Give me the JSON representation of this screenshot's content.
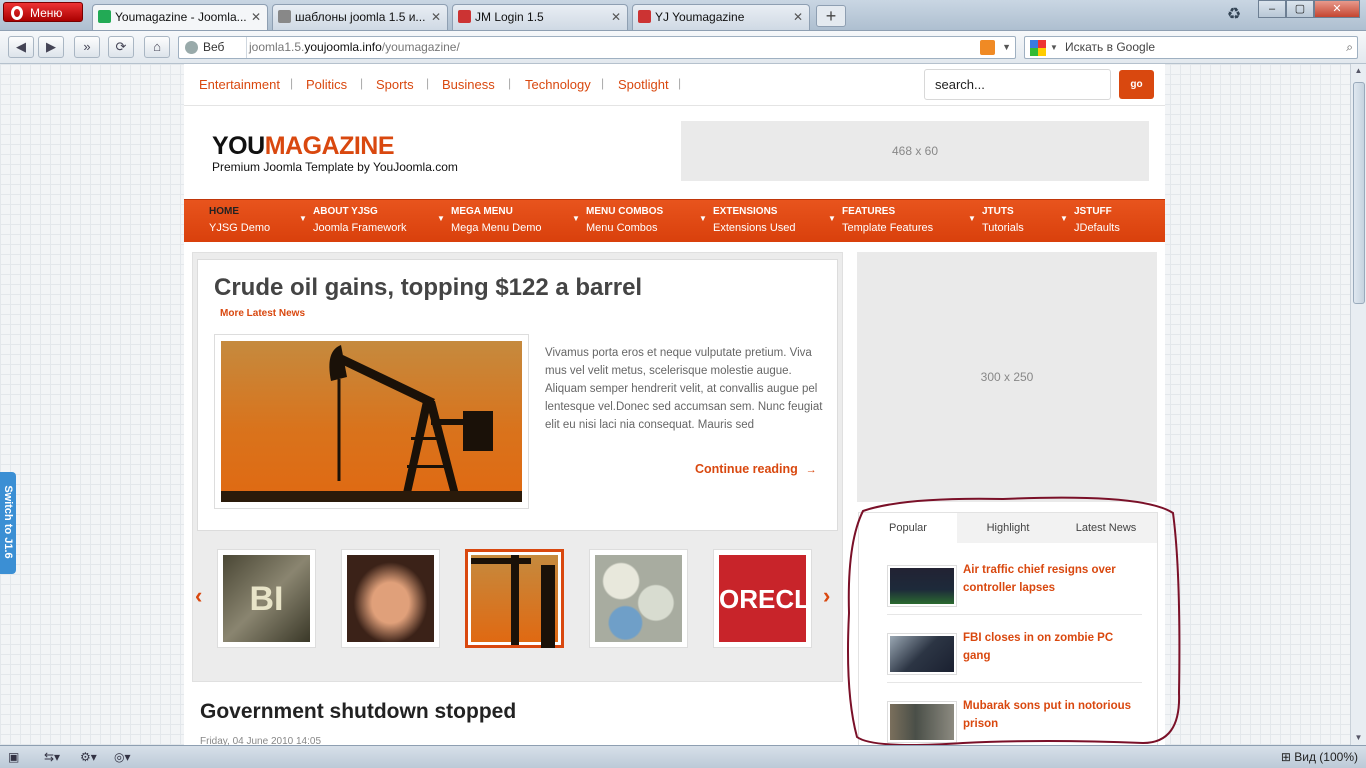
{
  "browser": {
    "menu_label": "Меню",
    "tabs": [
      {
        "title": "Youmagazine - Joomla...",
        "favicon_color": "#2a5"
      },
      {
        "title": "шаблоны joomla 1.5 и...",
        "favicon_color": "#777"
      },
      {
        "title": "JM Login 1.5",
        "favicon_color": "#c33"
      },
      {
        "title": "YJ Youmagazine",
        "favicon_color": "#c33"
      }
    ],
    "address": {
      "web_label": "Веб",
      "url_prefix": "joomla1.5.",
      "url_host": "youjoomla.info",
      "url_path": "/youmagazine/"
    },
    "search_placeholder": "Искать в Google",
    "zoom_label": "Вид (100%)"
  },
  "side_tab": {
    "label": "Switch to J1.6"
  },
  "site": {
    "top_links": [
      "Entertainment",
      "Politics",
      "Sports",
      "Business",
      "Technology",
      "Spotlight"
    ],
    "search_value": "search...",
    "go_label": "go",
    "logo_dark": "YOU",
    "logo_accent": "MAGAZINE",
    "tagline": "Premium Joomla Template by YouJoomla.com",
    "banner_top": "468 x 60",
    "banner_side": "300 x 250",
    "menu": [
      {
        "title": "HOME",
        "sub": "YJSG Demo"
      },
      {
        "title": "ABOUT YJSG",
        "sub": "Joomla Framework"
      },
      {
        "title": "MEGA MENU",
        "sub": "Mega Menu Demo"
      },
      {
        "title": "MENU COMBOS",
        "sub": "Menu Combos"
      },
      {
        "title": "EXTENSIONS",
        "sub": "Extensions Used"
      },
      {
        "title": "FEATURES",
        "sub": "Template Features"
      },
      {
        "title": "JTUTS",
        "sub": "Tutorials"
      },
      {
        "title": "JSTUFF",
        "sub": "JDefaults"
      }
    ],
    "featured": {
      "title": "Crude oil gains, topping $122 a barrel",
      "category": "More Latest News",
      "excerpt": "Vivamus porta eros et neque vulputate pretium. Viva mus vel velit metus, scelerisque molestie augue. Aliquam semper hendrerit velit, at convallis augue pel lentesque vel.Donec sed accumsan sem. Nunc feugiat elit eu nisi laci nia consequat. Mauris sed",
      "continue_label": "Continue reading"
    },
    "thumbnails": [
      {
        "name": "fbi-thumb",
        "bg": "#6f6a55"
      },
      {
        "name": "woman-thumb",
        "bg": "#5a3525"
      },
      {
        "name": "oil-thumb",
        "bg": "#d9731c"
      },
      {
        "name": "pills-thumb",
        "bg": "#bfc3b4"
      },
      {
        "name": "foreclosure-thumb",
        "bg": "#c8242a"
      }
    ],
    "article2": {
      "title": "Government shutdown stopped",
      "date": "Friday, 04 June 2010 14:05"
    },
    "tabs": [
      "Popular",
      "Highlight",
      "Latest News"
    ],
    "popular": [
      {
        "title": "Air traffic chief resigns over controller lapses",
        "thumb_bg": "#1d2a3a"
      },
      {
        "title": "FBI closes in on zombie PC gang",
        "thumb_bg": "#2c3544"
      },
      {
        "title": "Mubarak sons put in notorious prison",
        "thumb_bg": "#5b5f55"
      }
    ]
  },
  "colors": {
    "accent": "#d9480f",
    "annotation": "#7a1028"
  }
}
